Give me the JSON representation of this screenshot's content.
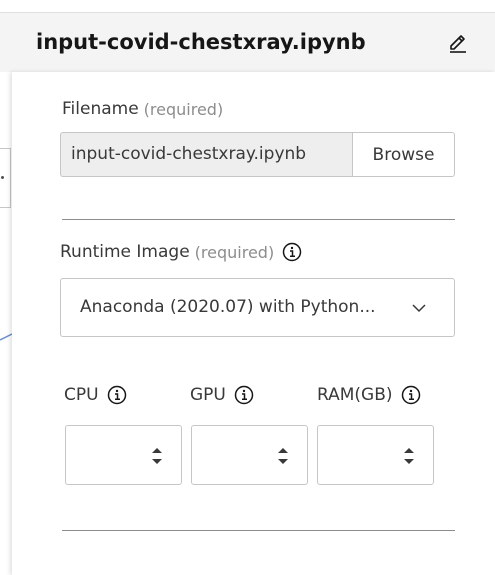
{
  "header": {
    "title": "input-covid-chestxray.ipynb",
    "edit_icon": "pencil-icon"
  },
  "filename": {
    "label": "Filename",
    "required_text": "(required)",
    "value": "input-covid-chestxray.ipynb",
    "browse_label": "Browse"
  },
  "runtime_image": {
    "label": "Runtime Image",
    "required_text": "(required)",
    "info_icon": "info-icon",
    "selected": "Anaconda (2020.07) with Python...",
    "chevron_icon": "chevron-down-icon"
  },
  "resources": [
    {
      "label": "CPU",
      "value": ""
    },
    {
      "label": "GPU",
      "value": ""
    },
    {
      "label": "RAM(GB)",
      "value": ""
    }
  ],
  "colors": {
    "header_bg": "#f4f4f4",
    "input_disabled_bg": "#eeeeee",
    "border": "#c6c6c6",
    "text": "#161616",
    "muted": "#8d8d8d"
  }
}
